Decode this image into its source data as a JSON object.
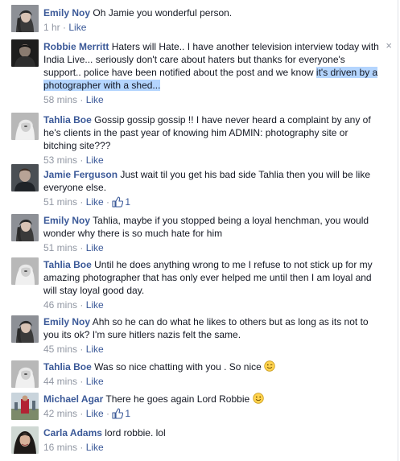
{
  "comments": [
    {
      "author": "Emily Noy",
      "text_before": "Oh Jamie you wonderful person.",
      "text_selected": "",
      "time": "1 hr",
      "like_label": "Like",
      "likes": "",
      "avatar": "emily-avatar"
    },
    {
      "author": "Robbie Merritt",
      "text_before": "Haters will Hate.. I have another television interview today with India Live... seriously don't care about haters but thanks for everyone's support.. police have been notified about the post and we know ",
      "text_selected": "it's driven by a photographer with a shed...",
      "time": "58 mins",
      "like_label": "Like",
      "likes": "",
      "avatar": "robbie-avatar"
    },
    {
      "author": "Tahlia Boe",
      "text_before": "Gossip gossip gossip !! I have never heard a complaint by any of he's clients in the past year of knowing him ADMIN: photography site or bitching site???",
      "text_selected": "",
      "time": "53 mins",
      "like_label": "Like",
      "likes": "",
      "avatar": "tahlia-avatar"
    },
    {
      "author": "Jamie Ferguson",
      "text_before": "Just wait til you get his bad side Tahlia then you will be like everyone else.",
      "text_selected": "",
      "time": "51 mins",
      "like_label": "Like",
      "likes": "1",
      "avatar": "jamie-avatar"
    },
    {
      "author": "Emily Noy",
      "text_before": "Tahlia, maybe if you stopped being a loyal henchman, you would wonder why there is so much hate for him",
      "text_selected": "",
      "time": "51 mins",
      "like_label": "Like",
      "likes": "",
      "avatar": "emily-avatar"
    },
    {
      "author": "Tahlia Boe",
      "text_before": "Until he does anything wrong to me I refuse to not stick up for my amazing photographer that has only ever helped me until then I am loyal and will stay loyal good day.",
      "text_selected": "",
      "time": "46 mins",
      "like_label": "Like",
      "likes": "",
      "avatar": "tahlia-avatar"
    },
    {
      "author": "Emily Noy",
      "text_before": "Ahh so he can do what he likes to others but as long as its not to you its ok? I'm sure hitlers nazis felt the same.",
      "text_selected": "",
      "time": "45 mins",
      "like_label": "Like",
      "likes": "",
      "avatar": "emily-avatar"
    },
    {
      "author": "Tahlia Boe",
      "text_before": "Was so nice chatting with you . So nice",
      "text_selected": "",
      "time": "44 mins",
      "like_label": "Like",
      "likes": "",
      "emoji": "wink-emoji",
      "avatar": "tahlia-avatar"
    },
    {
      "author": "Michael Agar",
      "text_before": "There he goes again Lord Robbie",
      "text_selected": "",
      "time": "42 mins",
      "like_label": "Like",
      "likes": "1",
      "emoji": "smile-emoji",
      "avatar": "michael-avatar"
    },
    {
      "author": "Carla Adams",
      "text_before": "lord robbie. lol",
      "text_selected": "",
      "time": "16 mins",
      "like_label": "Like",
      "likes": "",
      "avatar": "carla-avatar"
    }
  ],
  "close_glyph": "×",
  "meta_separator": " · ",
  "colors": {
    "link_blue": "#3b5998",
    "meta_gray": "#9197a3",
    "selection": "#b4d5fe",
    "row_highlight": "#f6f7f9"
  }
}
